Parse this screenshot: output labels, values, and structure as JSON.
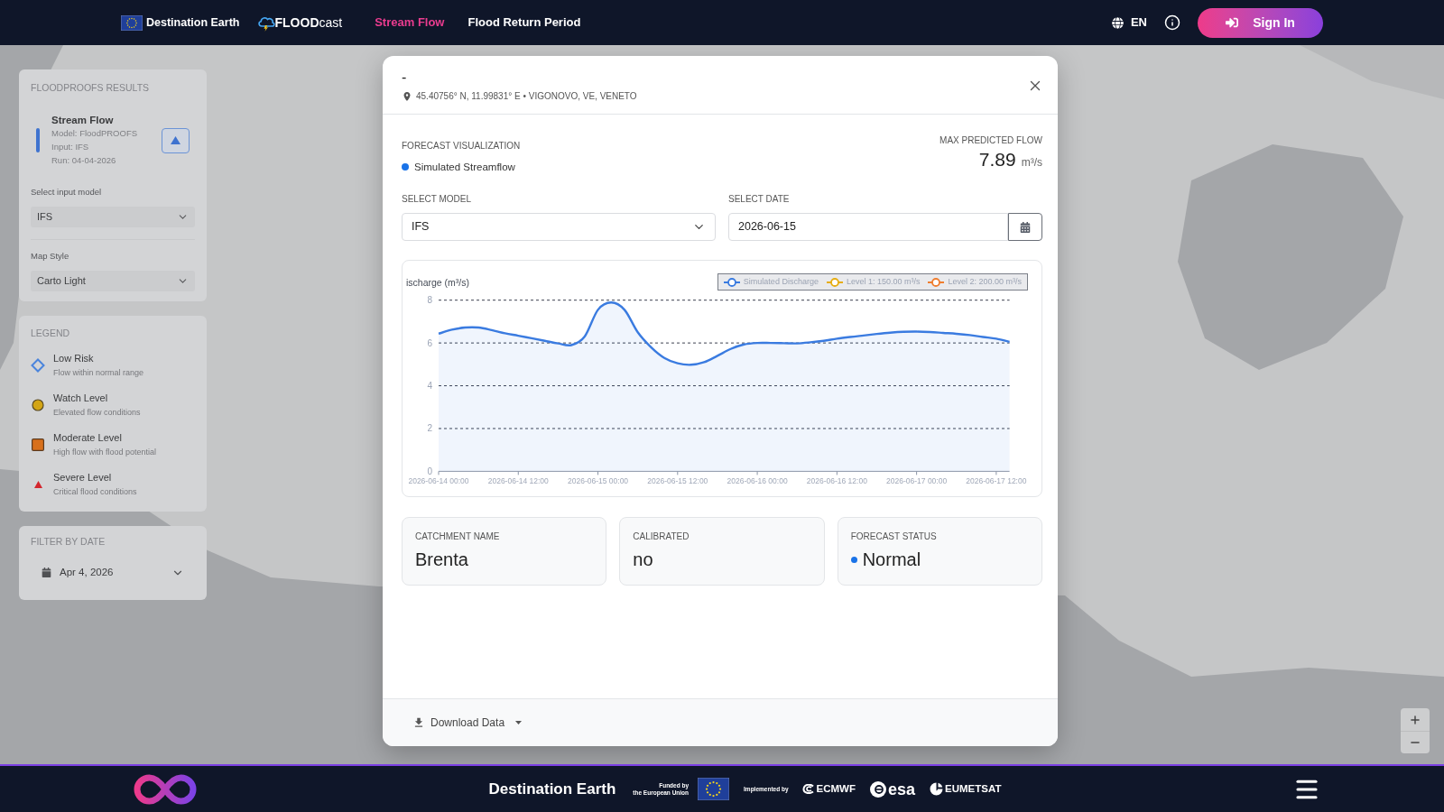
{
  "header": {
    "brand": "Destination Earth",
    "app_logo": "**FLOOD**cast",
    "nav": [
      {
        "label": "Stream Flow",
        "selected": true
      },
      {
        "label": "Flood Return Period",
        "selected": false
      }
    ],
    "language": "EN",
    "sign_in": "Sign In"
  },
  "sidebar": {
    "results_panel": {
      "title": "FLOODPROOFS RESULTS",
      "result": {
        "title": "Stream Flow",
        "lines": [
          "Model: FloodPROOFS",
          "Input: IFS",
          "Run: 04-04-2026"
        ]
      },
      "fields": [
        {
          "label": "Select input model",
          "value": "IFS"
        },
        {
          "label": "Map Style",
          "value": "Carto Light"
        }
      ]
    },
    "legend": {
      "title": "LEGEND",
      "items": [
        {
          "kind": "diamond",
          "color": "#4a84dc",
          "label": "Low Risk",
          "description": "Flow within normal range"
        },
        {
          "kind": "circle",
          "color": "#d3a515",
          "label": "Watch Level",
          "description": "Elevated flow conditions"
        },
        {
          "kind": "square",
          "color": "#d8701c",
          "label": "Moderate Level",
          "description": "High flow with flood potential"
        },
        {
          "kind": "triangle",
          "color": "#d3262e",
          "label": "Severe Level",
          "description": "Critical flood conditions"
        }
      ]
    },
    "date_filter": {
      "title": "FILTER BY DATE",
      "value": "Apr 4, 2026"
    }
  },
  "modal": {
    "title": "-",
    "location": "45.40756° N, 11.99831° E • VIGONOVO, VE, VENETO",
    "visualization": {
      "label": "FORECAST VISUALIZATION",
      "series": "Simulated Streamflow"
    },
    "max_flow": {
      "label": "MAX PREDICTED FLOW",
      "value": "7.89",
      "unit": "m³/s"
    },
    "model": {
      "label": "SELECT MODEL",
      "value": "IFS"
    },
    "date": {
      "label": "SELECT DATE",
      "value": "2026-06-15"
    },
    "chart_data": {
      "type": "area",
      "ylabel": "ischarge (m³/s)",
      "categories": [
        "2026-06-14 00:00",
        null,
        null,
        null,
        null,
        null,
        "2026-06-14 12:00",
        null,
        null,
        null,
        null,
        null,
        "2026-06-15 00:00",
        null,
        null,
        null,
        null,
        null,
        "2026-06-15 12:00",
        null,
        null,
        null,
        null,
        null,
        "2026-06-16 00:00",
        null,
        null,
        null,
        null,
        null,
        "2026-06-16 12:00",
        null,
        null,
        null,
        null,
        null,
        "2026-06-17 00:00",
        null,
        null,
        null,
        null,
        null,
        "2026-06-17 12:00",
        null
      ],
      "ylim": [
        0,
        8
      ],
      "yticks": [
        0,
        2,
        4,
        6,
        8
      ],
      "grid": true,
      "series": [
        {
          "name": "Simulated Discharge",
          "color": "#3a7be0",
          "values": [
            6.43,
            6.62,
            6.72,
            6.72,
            6.6,
            6.45,
            6.34,
            6.22,
            6.1,
            5.98,
            5.9,
            6.3,
            7.55,
            7.89,
            7.55,
            6.5,
            5.8,
            5.3,
            5.05,
            4.98,
            5.1,
            5.4,
            5.72,
            5.93,
            6.0,
            6.0,
            5.99,
            5.98,
            6.03,
            6.1,
            6.2,
            6.28,
            6.35,
            6.42,
            6.48,
            6.52,
            6.53,
            6.51,
            6.47,
            6.43,
            6.37,
            6.28,
            6.2,
            6.05
          ]
        },
        {
          "name": "Level 1: 150.00 m³/s",
          "color": "#e6ad12",
          "values": [
            null,
            null,
            null,
            null,
            null,
            null,
            null,
            null,
            null,
            null,
            null,
            null,
            null,
            null,
            null,
            null,
            null,
            null,
            null,
            null,
            null,
            null,
            null,
            null,
            null,
            null,
            null,
            null,
            null,
            null,
            null,
            null,
            null,
            null,
            null,
            null,
            null,
            null,
            null,
            null,
            null,
            null,
            null,
            null
          ]
        },
        {
          "name": "Level 2: 200.00 m³/s",
          "color": "#ef7d2f",
          "values": [
            null,
            null,
            null,
            null,
            null,
            null,
            null,
            null,
            null,
            null,
            null,
            null,
            null,
            null,
            null,
            null,
            null,
            null,
            null,
            null,
            null,
            null,
            null,
            null,
            null,
            null,
            null,
            null,
            null,
            null,
            null,
            null,
            null,
            null,
            null,
            null,
            null,
            null,
            null,
            null,
            null,
            null,
            null,
            null
          ]
        }
      ]
    },
    "info_cards": [
      {
        "label": "CATCHMENT NAME",
        "value": "Brenta"
      },
      {
        "label": "CALIBRATED",
        "value": "no"
      },
      {
        "label": "FORECAST STATUS",
        "value": "Normal",
        "color": "#1a73e8"
      }
    ],
    "download": "Download Data"
  },
  "footer": {
    "title": "Destination Earth",
    "funded_by": [
      "Funded by",
      "the European Union"
    ],
    "implemented_by": "Implemented by",
    "partners": [
      {
        "kind": "swirl",
        "name": "ECMWF"
      },
      {
        "kind": "circle",
        "name": "esa"
      },
      {
        "kind": "arc",
        "name": "EUMETSAT"
      }
    ]
  }
}
